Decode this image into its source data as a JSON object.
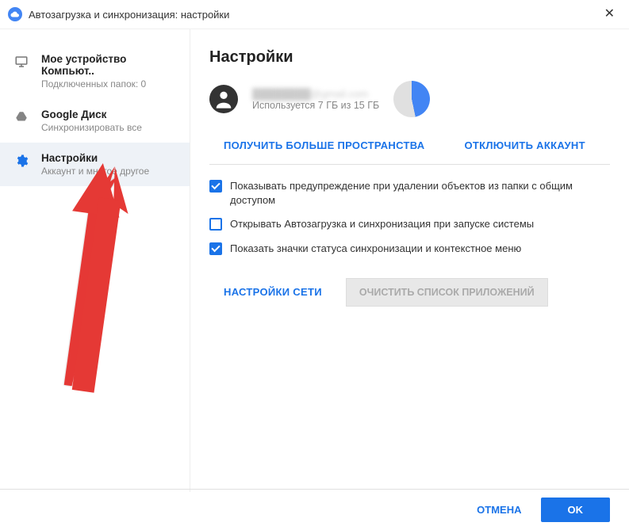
{
  "window": {
    "title": "Автозагрузка и синхронизация: настройки"
  },
  "sidebar": {
    "items": [
      {
        "title": "Мое устройство Компьют..",
        "sub": "Подключенных папок: 0"
      },
      {
        "title": "Google Диск",
        "sub": "Синхронизировать все"
      },
      {
        "title": "Настройки",
        "sub": "Аккаунт и многое другое"
      }
    ]
  },
  "main": {
    "heading": "Настройки",
    "account_email": "████████@gmail.com",
    "storage_text": "Используется 7 ГБ из 15 ГБ",
    "get_more_space": "ПОЛУЧИТЬ БОЛЬШЕ ПРОСТРАНСТВА",
    "disconnect_account": "ОТКЛЮЧИТЬ АККАУНТ",
    "checkboxes": [
      {
        "checked": true,
        "label": "Показывать предупреждение при удалении объектов из папки с общим доступом"
      },
      {
        "checked": false,
        "label": "Открывать Автозагрузка и синхронизация при запуске системы"
      },
      {
        "checked": true,
        "label": "Показать значки статуса синхронизации и контекстное меню"
      }
    ],
    "network_settings": "НАСТРОЙКИ СЕТИ",
    "clear_apps_list": "ОЧИСТИТЬ СПИСОК ПРИЛОЖЕНИЙ"
  },
  "footer": {
    "cancel": "ОТМЕНА",
    "ok": "OK"
  },
  "colors": {
    "accent": "#1a73e8"
  }
}
